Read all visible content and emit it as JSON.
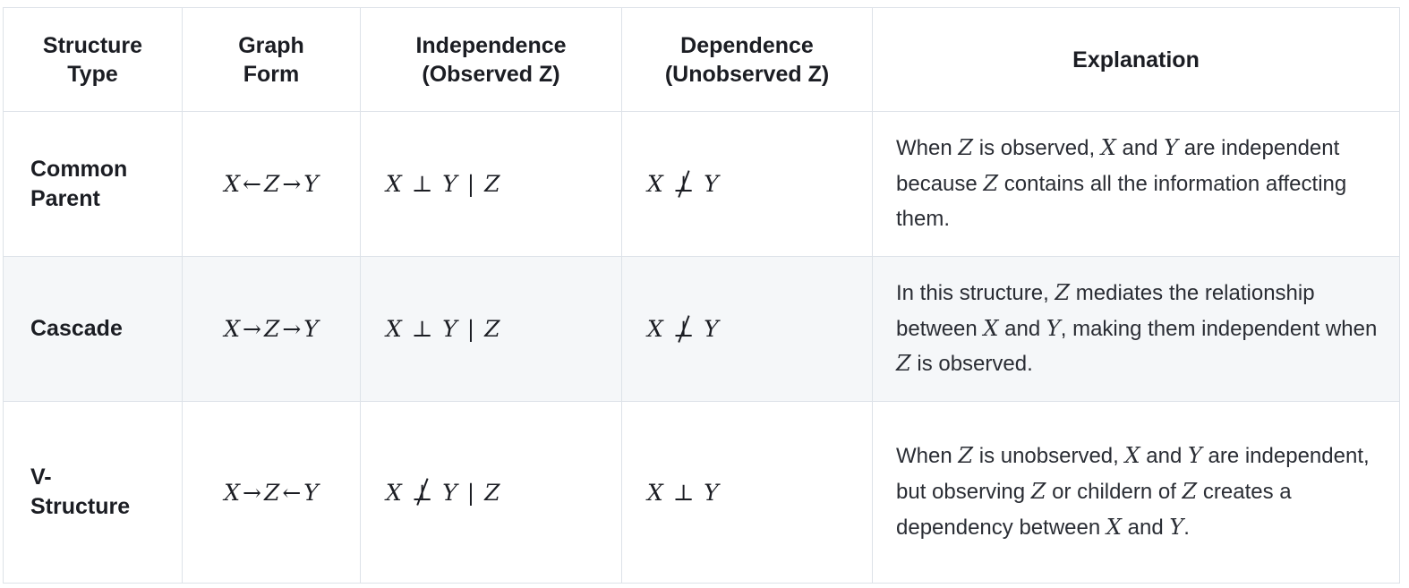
{
  "table": {
    "columns": [
      {
        "id": "structure-type",
        "line1": "Structure",
        "line2": "Type"
      },
      {
        "id": "graph-form",
        "line1": "Graph",
        "line2": "Form"
      },
      {
        "id": "independence",
        "line1": "Independence",
        "line2": "(Observed Z)"
      },
      {
        "id": "dependence",
        "line1": "Dependence",
        "line2": "(Unobserved Z)"
      },
      {
        "id": "explanation",
        "line1": "Explanation",
        "line2": ""
      }
    ],
    "rows": [
      {
        "type": "Common\nParent",
        "graph": {
          "a": "X",
          "op1": "←",
          "b": "Z",
          "op2": "→",
          "c": "Y"
        },
        "independence": {
          "a": "X",
          "rel": "⊥",
          "b": "Y",
          "bar": "|",
          "cond": "Z"
        },
        "dependence": {
          "a": "X",
          "rel": "⊥̸",
          "b": "Y"
        },
        "explanation_parts": [
          {
            "t": "When ",
            "i": false
          },
          {
            "t": "Z",
            "i": true
          },
          {
            "t": " is observed, ",
            "i": false
          },
          {
            "t": "X",
            "i": true
          },
          {
            "t": " and ",
            "i": false
          },
          {
            "t": "Y",
            "i": true
          },
          {
            "t": " are independent because ",
            "i": false
          },
          {
            "t": "Z",
            "i": true
          },
          {
            "t": " contains all the information affecting them.",
            "i": false
          }
        ],
        "explanation_text": "When Z is observed, X and Y are independent because Z contains all the information affecting them.",
        "shaded": false
      },
      {
        "type": "Cascade",
        "graph": {
          "a": "X",
          "op1": "→",
          "b": "Z",
          "op2": "→",
          "c": "Y"
        },
        "independence": {
          "a": "X",
          "rel": "⊥",
          "b": "Y",
          "bar": "|",
          "cond": "Z"
        },
        "dependence": {
          "a": "X",
          "rel": "⊥̸",
          "b": "Y"
        },
        "explanation_parts": [
          {
            "t": "In this structure, ",
            "i": false
          },
          {
            "t": "Z",
            "i": true
          },
          {
            "t": " mediates the relationship between ",
            "i": false
          },
          {
            "t": "X",
            "i": true
          },
          {
            "t": " and ",
            "i": false
          },
          {
            "t": "Y",
            "i": true
          },
          {
            "t": ", making them independent when ",
            "i": false
          },
          {
            "t": "Z",
            "i": true
          },
          {
            "t": " is observed.",
            "i": false
          }
        ],
        "explanation_text": "In this structure, Z mediates the relationship between X and Y, making them independent when Z is observed.",
        "shaded": true
      },
      {
        "type": "V-\nStructure",
        "graph": {
          "a": "X",
          "op1": "→",
          "b": "Z",
          "op2": "←",
          "c": "Y"
        },
        "independence": {
          "a": "X",
          "rel": "⊥̸",
          "b": "Y",
          "bar": "|",
          "cond": "Z"
        },
        "dependence": {
          "a": "X",
          "rel": "⊥",
          "b": "Y"
        },
        "explanation_parts": [
          {
            "t": "When ",
            "i": false
          },
          {
            "t": "Z",
            "i": true
          },
          {
            "t": " is unobserved, ",
            "i": false
          },
          {
            "t": "X",
            "i": true
          },
          {
            "t": " and ",
            "i": false
          },
          {
            "t": "Y",
            "i": true
          },
          {
            "t": " are independent, but observing ",
            "i": false
          },
          {
            "t": "Z",
            "i": true
          },
          {
            "t": " or childern of ",
            "i": false
          },
          {
            "t": "Z",
            "i": true
          },
          {
            "t": " creates a dependency between ",
            "i": false
          },
          {
            "t": "X",
            "i": true
          },
          {
            "t": " and ",
            "i": false
          },
          {
            "t": "Y",
            "i": true
          },
          {
            "t": ".",
            "i": false
          }
        ],
        "explanation_text": "When Z is unobserved, X and Y are independent, but observing Z or childern of Z creates a dependency between X and Y.",
        "shaded": false
      }
    ]
  },
  "colors": {
    "border": "#dde2e8",
    "shaded_row": "#f5f7f9",
    "text": "#1b1d23",
    "body_text": "#2a2d34",
    "background": "#ffffff"
  }
}
